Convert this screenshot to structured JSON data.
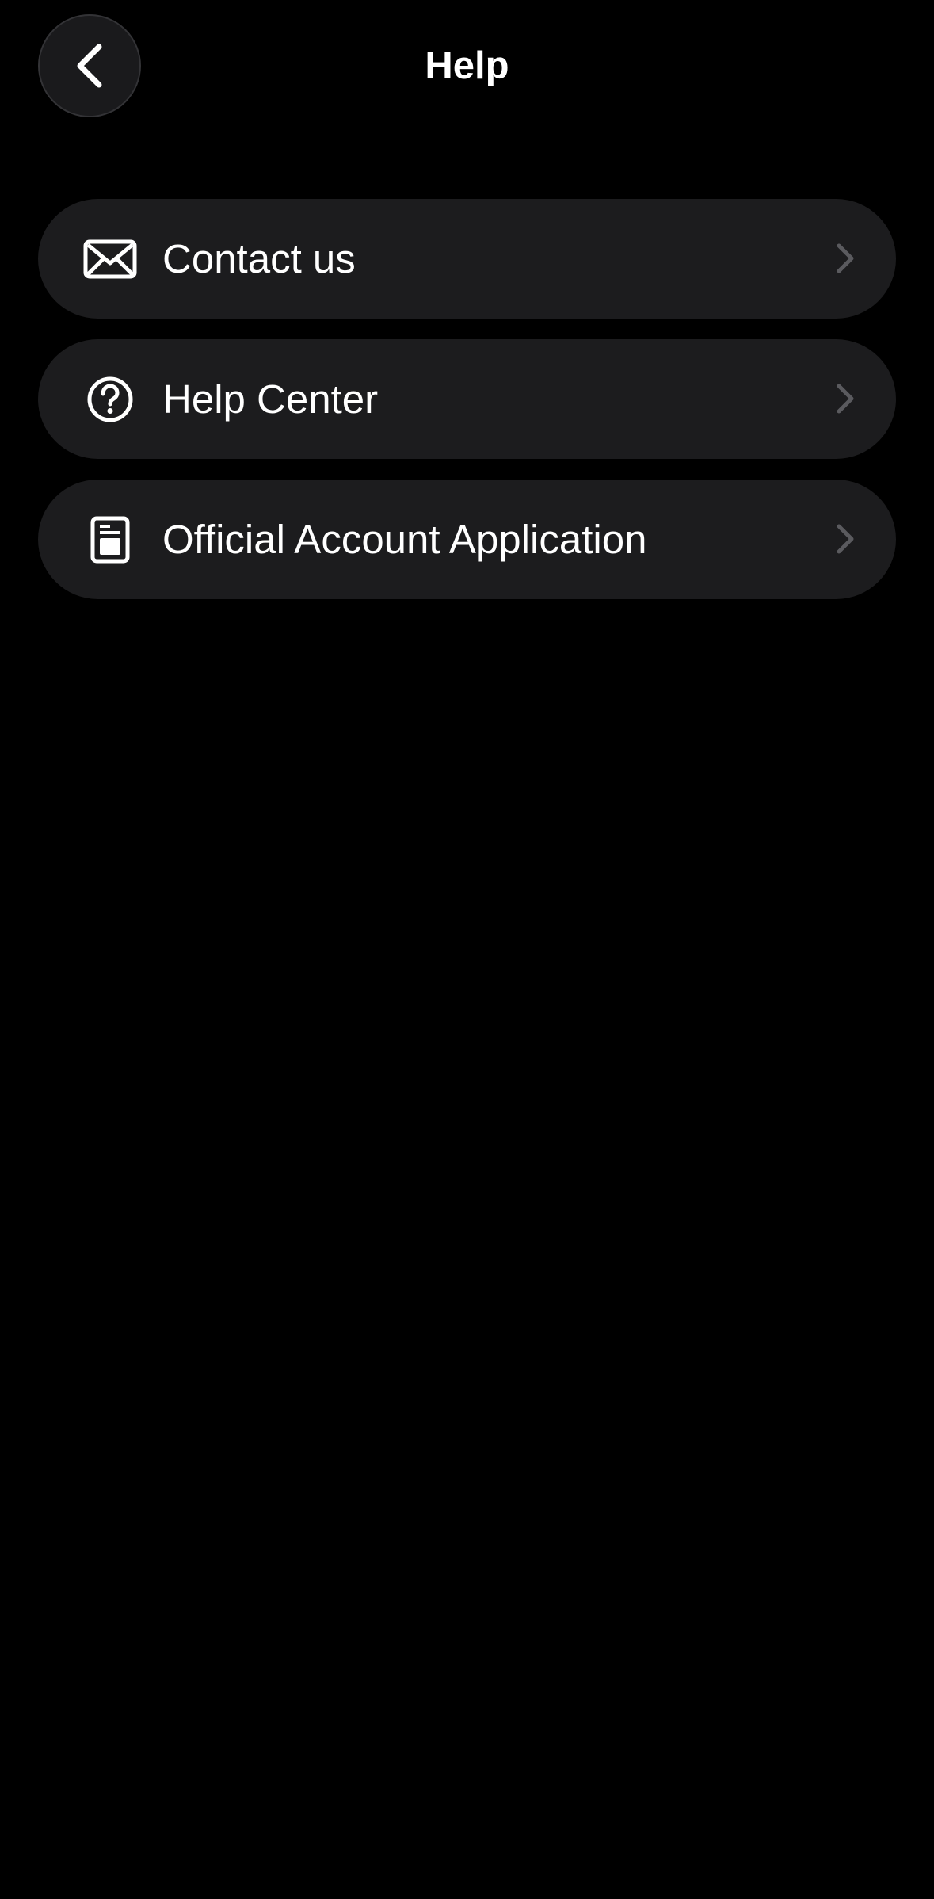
{
  "header": {
    "title": "Help",
    "back_icon": "chevron-left-icon"
  },
  "menu": {
    "items": [
      {
        "label": "Contact us",
        "icon": "envelope-icon"
      },
      {
        "label": "Help Center",
        "icon": "question-circle-icon"
      },
      {
        "label": "Official Account Application",
        "icon": "document-icon"
      }
    ],
    "chevron_icon": "chevron-right-icon"
  },
  "colors": {
    "background": "#000000",
    "card": "#1c1c1e",
    "text": "#ffffff",
    "chevron": "#5a5a5e"
  }
}
